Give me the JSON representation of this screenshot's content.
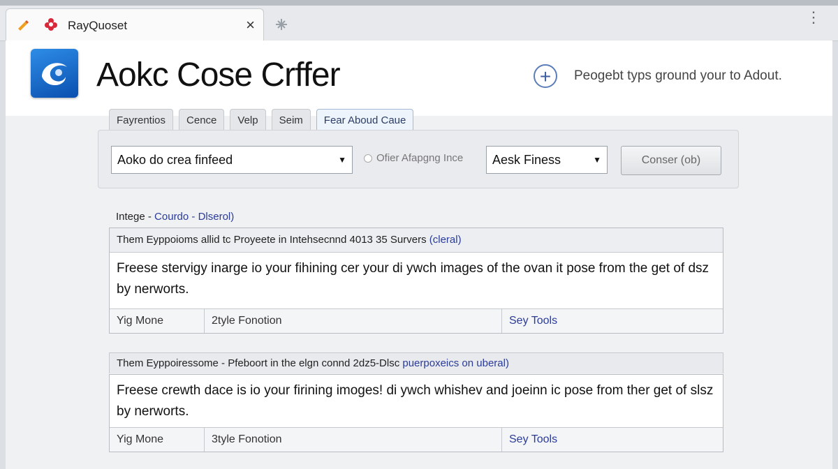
{
  "browser": {
    "tab_title": "RayQuoset",
    "close_glyph": "×",
    "menu_glyph": "⋮"
  },
  "header": {
    "title": "Aokc Cose Crffer",
    "action_text": "Peogebt typs ground your to Adout.",
    "action_icon": "plus-circle-icon"
  },
  "tabs": [
    {
      "label": "Fayrentios"
    },
    {
      "label": "Cence"
    },
    {
      "label": "Velp"
    },
    {
      "label": "Seim"
    },
    {
      "label": "Fear Aboud Caue",
      "active": true
    }
  ],
  "toolbar": {
    "main_select": "Aoko do crea finfeed",
    "radio_label": "Ofier Afapgng Ince",
    "secondary_select": "Aesk Finess",
    "cancel_label": "Conser (ob)",
    "arrow": "▼"
  },
  "section1": {
    "head_text": "Intege - ",
    "head_link": "Courdo - Dlserol)"
  },
  "cards": [
    {
      "subhead_text": "Them Eyppoioms allid tc Proyeete in Intehsecnnd 4013 35 Survers ",
      "subhead_link": "(cleral)",
      "body": "Freese stervigy inarge io your fihining cer your di ywch images of the ovan it pose from the get of dsz by nerworts.",
      "footer": [
        "Yig Mone",
        "2tyle Fonotion",
        "Sey Tools"
      ]
    },
    {
      "subhead_text": "Them Eyppoiressome - Pfeboort in the elgn connd 2dz5-Dlsc ",
      "subhead_link": "puerpoxeics on uberal)",
      "body": "Freese crewth dace is io your firining imoges! di ywch whishev and joeinn ic pose from ther get of slsz by nerworts.",
      "footer": [
        "Yig Mone",
        "3tyle Fonotion",
        "Sey Tools"
      ]
    }
  ],
  "colors": {
    "accent": "#2a3b9a",
    "logo_blue": "#1a6fd2"
  }
}
